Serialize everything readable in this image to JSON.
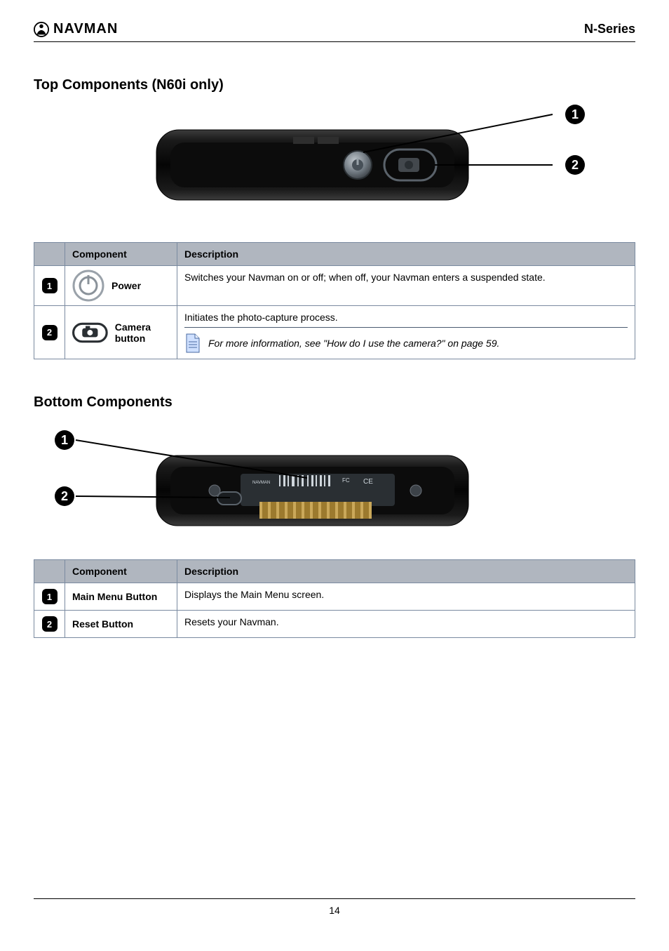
{
  "header": {
    "brand": "NAVMAN",
    "series": "N-Series"
  },
  "sections": {
    "top": {
      "title": "Top Components (N60i only)",
      "table": {
        "head": {
          "component": "Component",
          "description": "Description"
        },
        "rows": [
          {
            "num": "1",
            "component": "Power",
            "description": "Switches your Navman on or off; when off, your Navman enters a suspended state."
          },
          {
            "num": "2",
            "component": "Camera button",
            "description": "Initiates the photo-capture process.",
            "note": "For more information, see \"How do I use the camera?\" on page 59."
          }
        ]
      }
    },
    "bottom": {
      "title": "Bottom Components",
      "table": {
        "head": {
          "component": "Component",
          "description": "Description"
        },
        "rows": [
          {
            "num": "1",
            "component": "Main Menu Button",
            "description": "Displays the Main Menu screen."
          },
          {
            "num": "2",
            "component": "Reset Button",
            "description": "Resets your Navman."
          }
        ]
      }
    }
  },
  "footer": {
    "page": "14"
  }
}
